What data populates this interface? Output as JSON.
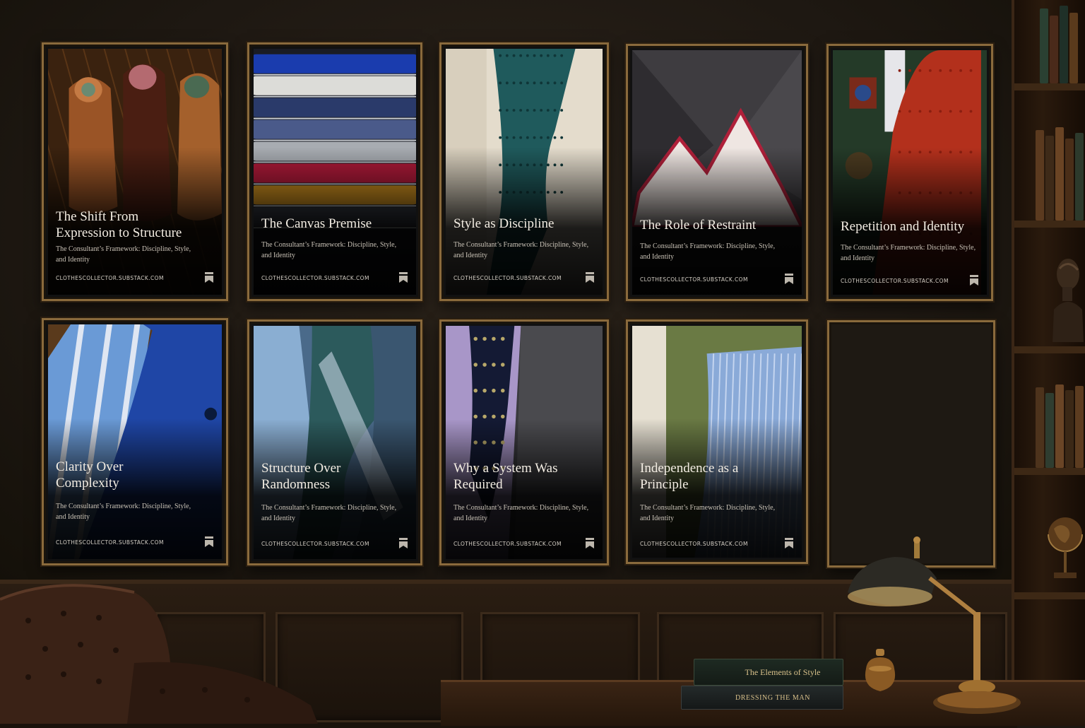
{
  "posters": [
    {
      "title_lines": [
        "The Shift From",
        "Expression to Structure"
      ],
      "subtitle_lines": [
        "The Consultant’s Framework: Discipline, Style,",
        "and Identity"
      ],
      "site": "CLOTHESCOLLECTOR.SUBSTACK.COM",
      "scene": "shoes"
    },
    {
      "title_lines": [
        "The Canvas Premise"
      ],
      "subtitle_lines": [
        "The Consultant’s Framework: Discipline, Style,",
        "and Identity"
      ],
      "site": "CLOTHESCOLLECTOR.SUBSTACK.COM",
      "scene": "folded-fabrics"
    },
    {
      "title_lines": [
        "Style as Discipline"
      ],
      "subtitle_lines": [
        "The Consultant’s Framework: Discipline, Style,",
        "and Identity"
      ],
      "site": "CLOTHESCOLLECTOR.SUBSTACK.COM",
      "scene": "teal-knit-tie"
    },
    {
      "title_lines": [
        "The Role of Restraint"
      ],
      "subtitle_lines": [
        "The Consultant’s Framework: Discipline, Style,",
        "and Identity"
      ],
      "site": "CLOTHESCOLLECTOR.SUBSTACK.COM",
      "scene": "pocket-square"
    },
    {
      "title_lines": [
        "Repetition and Identity"
      ],
      "subtitle_lines": [
        "The Consultant’s Framework: Discipline, Style,",
        "and Identity"
      ],
      "site": "CLOTHESCOLLECTOR.SUBSTACK.COM",
      "scene": "red-tie"
    },
    {
      "title_lines": [
        "Clarity Over",
        "Complexity"
      ],
      "subtitle_lines": [
        "The Consultant’s Framework: Discipline, Style,",
        "and Identity"
      ],
      "site": "CLOTHESCOLLECTOR.SUBSTACK.COM",
      "scene": "blue-jacket"
    },
    {
      "title_lines": [
        "Structure Over",
        "Randomness"
      ],
      "subtitle_lines": [
        "The Consultant’s Framework: Discipline, Style,",
        "and Identity"
      ],
      "site": "CLOTHESCOLLECTOR.SUBSTACK.COM",
      "scene": "blue-knit-tie"
    },
    {
      "title_lines": [
        "Why a System Was",
        "Required"
      ],
      "subtitle_lines": [
        "The Consultant’s Framework: Discipline, Style,",
        "and Identity"
      ],
      "site": "CLOTHESCOLLECTOR.SUBSTACK.COM",
      "scene": "navy-tie-lilac-shirt"
    },
    {
      "title_lines": [
        "Independence as a",
        "Principle"
      ],
      "subtitle_lines": [
        "The Consultant’s Framework: Discipline, Style,",
        "and Identity"
      ],
      "site": "CLOTHESCOLLECTOR.SUBSTACK.COM",
      "scene": "blue-pocket-square"
    }
  ],
  "empty_frame": true,
  "desk_books": {
    "top": "The Elements of Style",
    "bottom": "DRESSING THE MAN"
  },
  "colors": {
    "frame_gold": "#8a6a3c",
    "wall": "#241d15",
    "title_text": "#f3ede3"
  }
}
